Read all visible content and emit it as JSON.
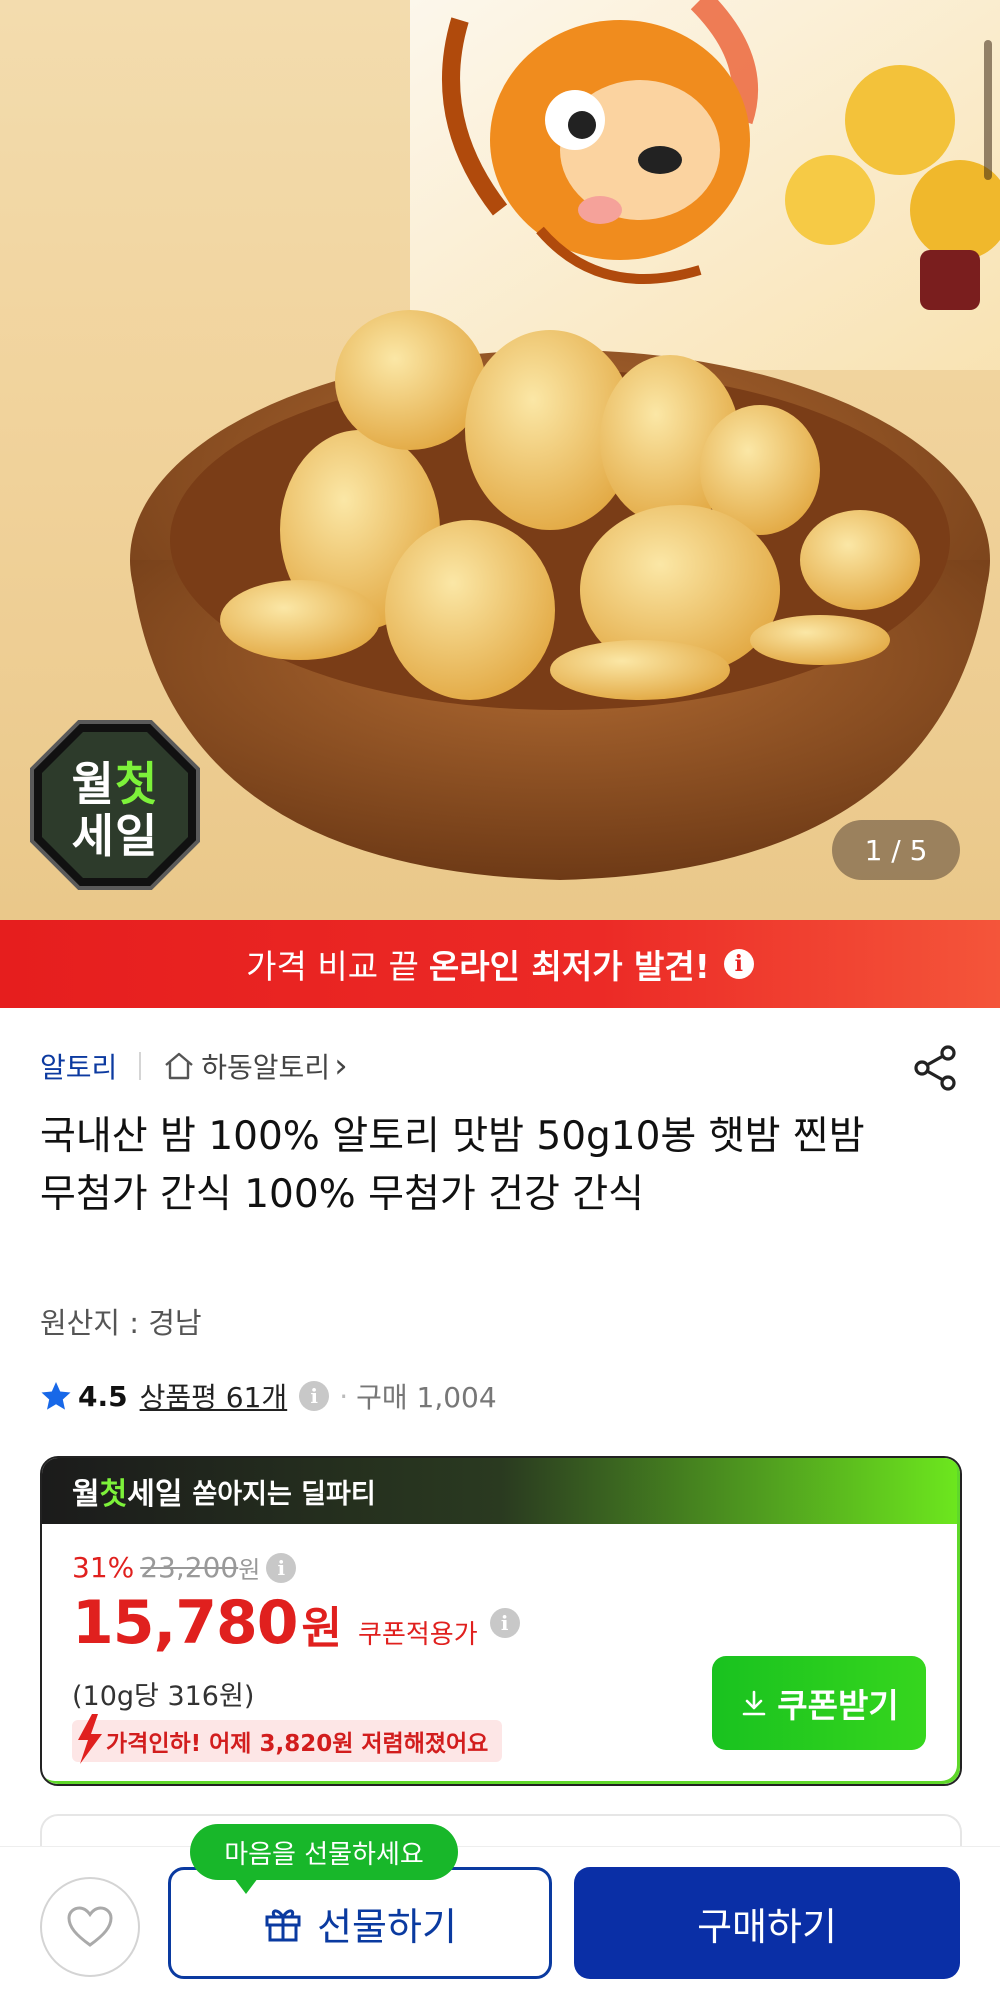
{
  "hero": {
    "badge_line1_a": "월",
    "badge_line1_b": "첫",
    "badge_line2": "세일",
    "counter": "1 / 5"
  },
  "banner": {
    "light": "가격 비교 끝",
    "bold": "온라인 최저가 발견!",
    "info": "i"
  },
  "product": {
    "brand": "알토리",
    "store": "하동알토리",
    "store_arrow": "›",
    "title": "국내산 밤 100% 알토리 맛밤 50g10봉 햇밤 찐밤 무첨가 간식 100% 무첨가 건강 간식",
    "origin": "원산지 : 경남",
    "rating": "4.5",
    "reviews": "상품평 61개",
    "info": "i",
    "dot": "·",
    "purchases": "구매 1,004"
  },
  "deal": {
    "head_w": "월",
    "head_g": "첫",
    "head_s": "세일",
    "head_rest": "쏟아지는 딜파티",
    "discount": "31%",
    "original_price": "23,200",
    "original_won": "원",
    "price": "15,780",
    "price_won": "원",
    "coupon_label": "쿠폰적용가",
    "info": "i",
    "unit_price": "(10g당 316원)",
    "price_drop": "가격인하! 어제 3,820원 저렴해졌어요",
    "coupon_button": "쿠폰받기"
  },
  "bottom": {
    "tooltip": "마음을 선물하세요",
    "gift_button": "선물하기",
    "buy_button": "구매하기"
  },
  "colors": {
    "brand_blue": "#0a2fa6",
    "sale_red": "#e0201e",
    "coupon_green": "#19c21f"
  }
}
